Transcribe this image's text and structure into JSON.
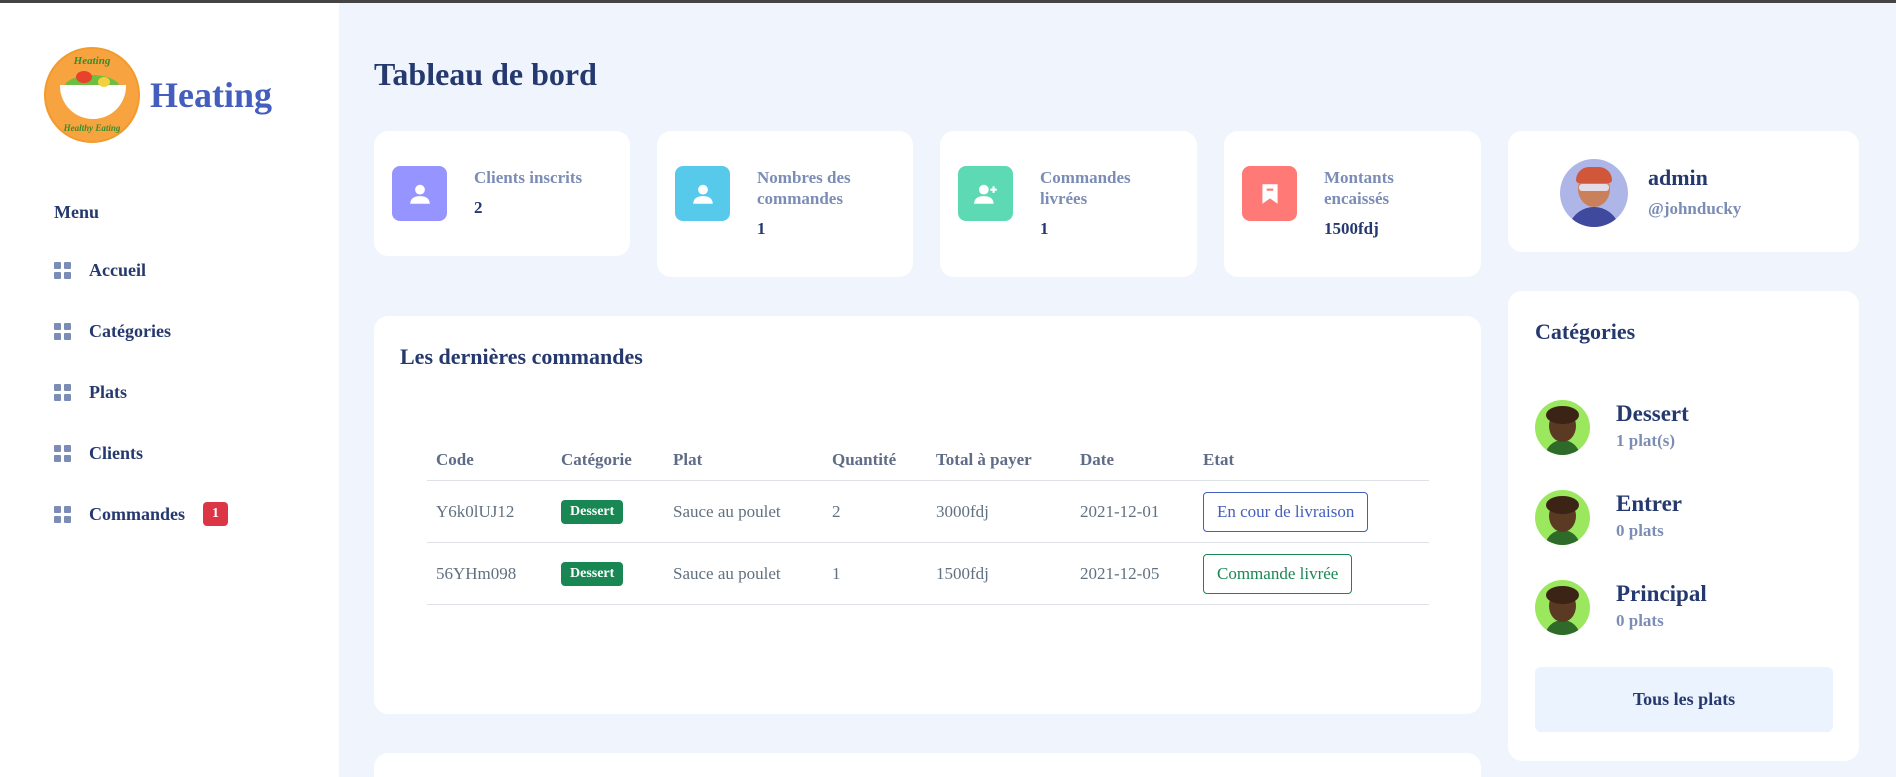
{
  "brand": {
    "name": "Heating",
    "logo_text_top": "Heating",
    "logo_text_bottom": "Healthy Eating"
  },
  "sidebar": {
    "menu_label": "Menu",
    "items": [
      {
        "label": "Accueil",
        "icon": "grid-icon"
      },
      {
        "label": "Catégories",
        "icon": "grid-icon"
      },
      {
        "label": "Plats",
        "icon": "grid-icon"
      },
      {
        "label": "Clients",
        "icon": "grid-icon"
      },
      {
        "label": "Commandes",
        "icon": "grid-icon",
        "badge": "1"
      }
    ]
  },
  "page": {
    "title": "Tableau de bord"
  },
  "stats": [
    {
      "label": "Clients inscrits",
      "value": "2",
      "icon": "user-icon",
      "color": "#9694ff"
    },
    {
      "label": "Nombres des commandes",
      "value": "1",
      "icon": "user-icon",
      "color": "#57caeb"
    },
    {
      "label": "Commandes livrées",
      "value": "1",
      "icon": "user-plus-icon",
      "color": "#5ddab4"
    },
    {
      "label": "Montants encaissés",
      "value": "1500fdj",
      "icon": "bookmark-icon",
      "color": "#ff7976"
    }
  ],
  "profile": {
    "name": "admin",
    "handle": "@johnducky"
  },
  "orders": {
    "title": "Les dernières commandes",
    "columns": [
      "Code",
      "Catégorie",
      "Plat",
      "Quantité",
      "Total à payer",
      "Date",
      "Etat"
    ],
    "rows": [
      {
        "code": "Y6k0lUJ12",
        "category": "Dessert",
        "dish": "Sauce au poulet",
        "quantity": "2",
        "total": "3000fdj",
        "date": "2021-12-01",
        "state": "En cour de livraison"
      },
      {
        "code": "56YHm098",
        "category": "Dessert",
        "dish": "Sauce au poulet",
        "quantity": "1",
        "total": "1500fdj",
        "date": "2021-12-05",
        "state": "Commande livrée"
      }
    ]
  },
  "categories": {
    "title": "Catégories",
    "items": [
      {
        "name": "Dessert",
        "count": "1 plat(s)"
      },
      {
        "name": "Entrer",
        "count": "0 plats"
      },
      {
        "name": "Principal",
        "count": "0 plats"
      }
    ],
    "all_button": "Tous les plats"
  }
}
